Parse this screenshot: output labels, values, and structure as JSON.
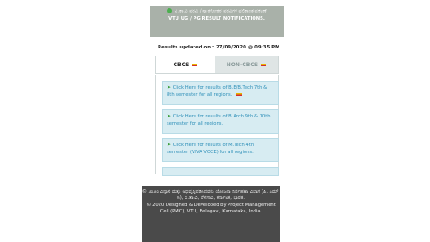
{
  "banner": {
    "kannada_title": "ವಿ.ತಾ.ವಿ ಪದವಿ / ಸ್ನಾತಕೋತ್ತರ ಪದವಿಗಳ ಫಲಿತಾಂಶ ಪ್ರಕಟಣೆ",
    "english_title": "VTU UG / PG RESULT NOTIFICATIONS."
  },
  "results_updated": "Results updated on : 27/09/2020 @ 09:35 PM.",
  "tabs": [
    {
      "label": "CBCS"
    },
    {
      "label": "NON-CBCS"
    }
  ],
  "cards": [
    {
      "text": "Click Here for results of B.E/B.Tech 7th & 8th semester for all regions."
    },
    {
      "text": "Click Here for results of B.Arch 9th & 10th semester for all regions."
    },
    {
      "text": "Click Here for results of M.Tech 4th semester (VIVA VOCE) for all regions."
    }
  ],
  "footer": {
    "kannada_line": "© ೨೦೨೦ ವಿನ್ಯಾಸ ಮತ್ತು ಅಭಿವೃದ್ಧಿಪಡಿಸಿದವರು ಯೋಜನಾ ನಿರ್ವಹಣಾ ವಿಭಾಗ (ಪಿ. ಎಮ್. ಸಿ), ವಿ.ತಾ.ವಿ, ಬೆಳಗಾವಿ, ಕರ್ನಾಟಕ, ಭಾರತ.",
    "english_line": "© 2020 Designed & Developed by Project Management Cell (PMC), VTU, Belagavi, Karnataka, India."
  }
}
